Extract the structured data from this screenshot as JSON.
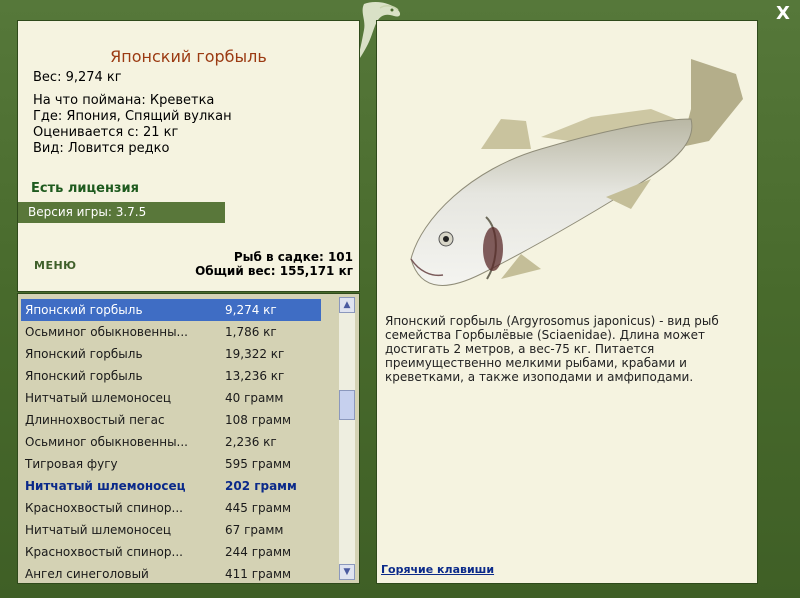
{
  "fish": {
    "title": "Японский горбыль",
    "weight": "Вес: 9,274 кг",
    "caught_on": "На что поймана: Креветка",
    "location": "Где: Япония, Спящий вулкан",
    "valued_from": "Оценивается с: 21 кг",
    "species": "Вид: Ловится редко"
  },
  "license": "Есть лицензия",
  "version": "Версия игры: 3.7.5",
  "menu_label": "МЕНЮ",
  "stats": {
    "fish_in_net": "Рыб в садке: 101",
    "total_weight": "Общий вес: 155,171 кг"
  },
  "list": [
    {
      "name": "Японский горбыль",
      "weight": "9,274 кг",
      "state": "selected"
    },
    {
      "name": "Осьминог обыкновенны...",
      "weight": "1,786 кг",
      "state": ""
    },
    {
      "name": "Японский горбыль",
      "weight": "19,322 кг",
      "state": ""
    },
    {
      "name": "Японский горбыль",
      "weight": "13,236 кг",
      "state": ""
    },
    {
      "name": "Нитчатый шлемоносец",
      "weight": "40 грамм",
      "state": ""
    },
    {
      "name": "Длиннохвостый пегас",
      "weight": "108 грамм",
      "state": ""
    },
    {
      "name": "Осьминог обыкновенны...",
      "weight": "2,236 кг",
      "state": ""
    },
    {
      "name": "Тигровая фугу",
      "weight": "595 грамм",
      "state": ""
    },
    {
      "name": "Нитчатый шлемоносец",
      "weight": "202 грамм",
      "state": "highlight"
    },
    {
      "name": "Краснохвостый спинор...",
      "weight": "445 грамм",
      "state": ""
    },
    {
      "name": "Нитчатый шлемоносец",
      "weight": "67 грамм",
      "state": ""
    },
    {
      "name": "Краснохвостый спинор...",
      "weight": "244 грамм",
      "state": ""
    },
    {
      "name": "Ангел синеголовый",
      "weight": "411 грамм",
      "state": ""
    }
  ],
  "description": "Японский горбыль (Argyrosomus japonicus) - вид рыб семейства Горбылёвые (Sciaenidae). Длина может достигать 2 метров, а вес-75 кг. Питается преимущественно мелкими рыбами, крабами и креветками, а также изоподами и амфиподами.",
  "hotkeys_label": "Горячие клавиши",
  "close_label": "X",
  "icons": {
    "close": "close-icon",
    "logo": "fish-logo-icon",
    "scroll_up": "chevron-up-icon",
    "scroll_down": "chevron-down-icon"
  },
  "colors": {
    "frame": "#4a6a2e",
    "panel": "#f5f3e0",
    "list_bg": "#d4d2b4",
    "selected": "#3f6dc4",
    "title": "#9b3a12",
    "link": "#0b2a8a"
  }
}
